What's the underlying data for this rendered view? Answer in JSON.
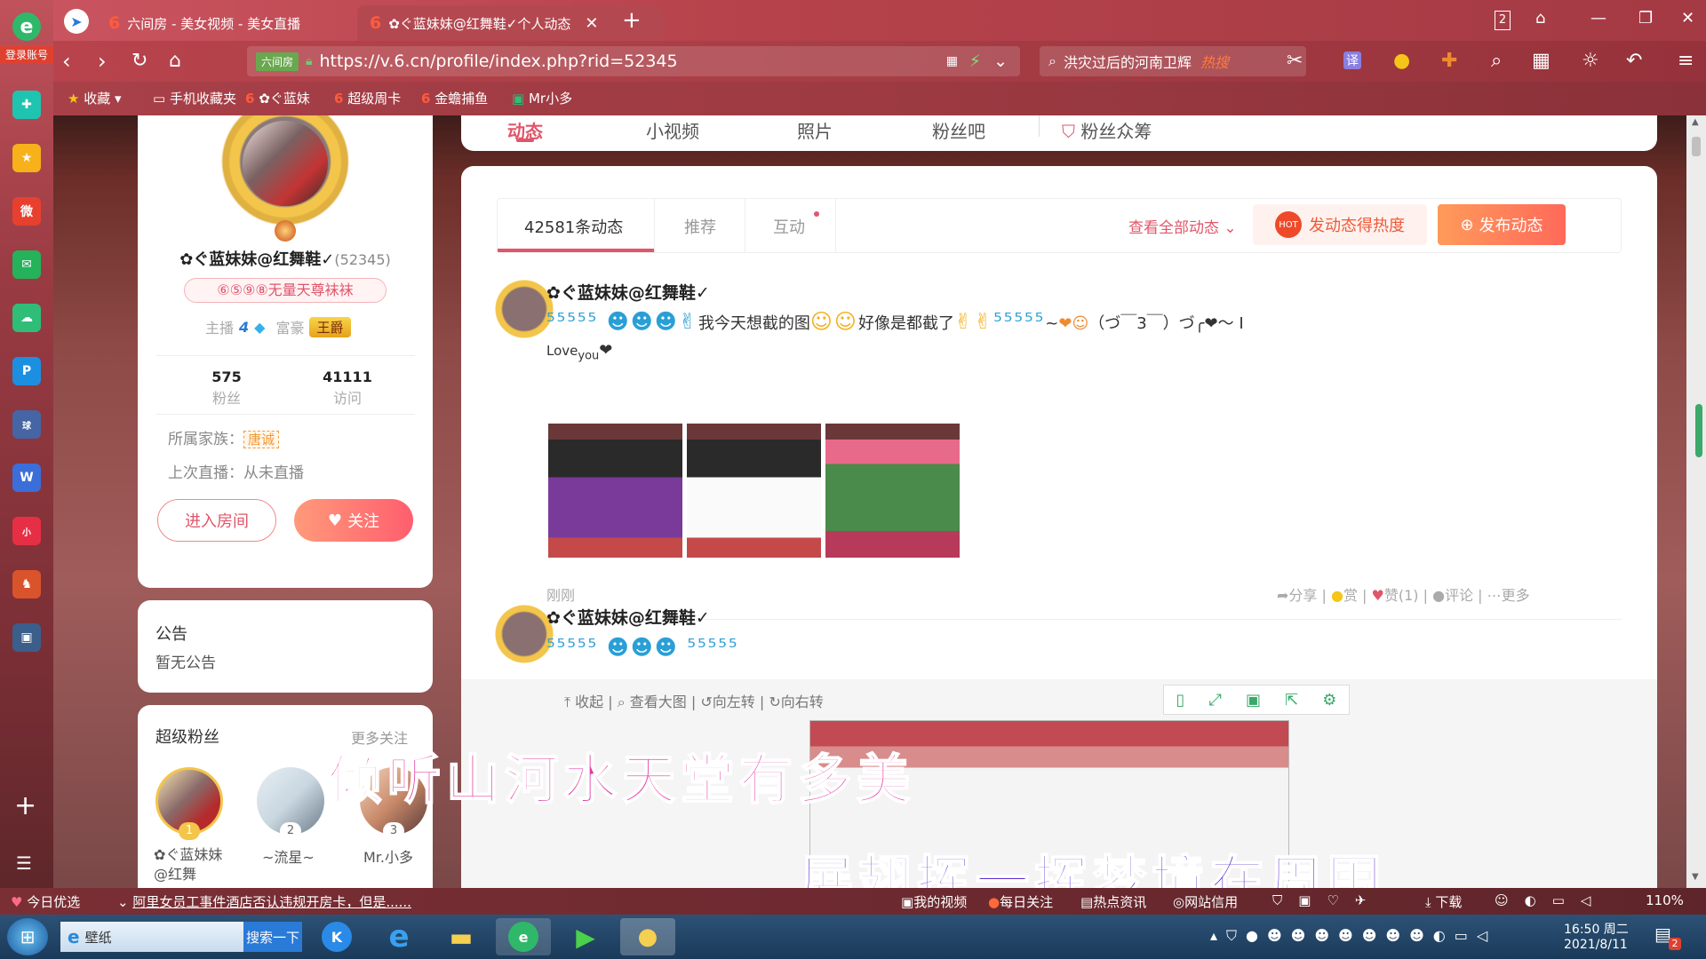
{
  "browser": {
    "tabs": [
      {
        "label": "六间房 - 美女视频 - 美女直播"
      },
      {
        "label": "✿ぐ蓝妹妹@红舞鞋✓个人动态"
      }
    ],
    "tab_count": "2",
    "url": "https://v.6.cn/profile/index.php?rid=52345",
    "shield_label": "六间房",
    "search_text": "洪灾过后的河南卫辉",
    "search_hot": "热搜",
    "login_label": "登录账号",
    "translate_label": "译",
    "bookmarks": [
      "收藏",
      "手机收藏夹",
      "✿ぐ蓝妹",
      "超级周卡",
      "金蟾捕鱼",
      "Mr小多"
    ]
  },
  "profile": {
    "name": "✿ぐ蓝妹妹@红舞鞋✓",
    "rid": "(52345)",
    "title_badge": "⑥⑤⑨⑧无量天尊袜袜",
    "anchor_label": "主播",
    "anchor_level": "4",
    "rich_label": "富豪",
    "rich_badge": "王爵",
    "fans_count": "575",
    "fans_label": "粉丝",
    "visits_count": "41111",
    "visits_label": "访问",
    "family_label": "所属家族：",
    "family_badge": "唐诚",
    "last_live": "上次直播：从未直播",
    "enter_room": "进入房间",
    "follow": "关注"
  },
  "notice": {
    "title": "公告",
    "text": "暂无公告"
  },
  "super_fans": {
    "title": "超级粉丝",
    "more": "更多关注",
    "fans": [
      {
        "rank": "1",
        "name": "✿ぐ蓝妹妹@红舞"
      },
      {
        "rank": "2",
        "name": "~流星~"
      },
      {
        "rank": "3",
        "name": "Mr.小多"
      }
    ]
  },
  "top_nav": {
    "items": [
      "动态",
      "小视频",
      "照片",
      "粉丝吧",
      "粉丝众筹"
    ]
  },
  "feed": {
    "tabs": [
      "42581条动态",
      "推荐",
      "互动"
    ],
    "view_all": "查看全部动态",
    "heat_button": "发动态得热度",
    "publish_button": "发布动态",
    "posts": [
      {
        "author": "✿ぐ蓝妹妹@红舞鞋✓",
        "text_main": "我今天想截的图",
        "text_mid": "好像是都截了",
        "text_tail": "（づ￣3￣）づ╭❤～ I",
        "text_love": "Love",
        "text_you": "you",
        "time": "刚刚",
        "actions": {
          "share": "分享",
          "reward": "赏",
          "like": "赞(1)",
          "comment": "评论",
          "more": "更多"
        }
      },
      {
        "author": "✿ぐ蓝妹妹@红舞鞋✓",
        "image_actions": [
          "收起",
          "查看大图",
          "向左转",
          "向右转"
        ]
      }
    ]
  },
  "lyrics": {
    "line1": "倾听山河水天堂有多美",
    "line2": "展翅挥一挥梦境在周围"
  },
  "status_bar": {
    "daily": "今日优选",
    "news": "阿里女员工事件酒店否认违规开房卡，但是......",
    "items": [
      "我的视频",
      "每日关注",
      "热点资讯",
      "网站信用"
    ],
    "download": "下载",
    "zoom": "110%"
  },
  "taskbar": {
    "ie_label": "壁纸",
    "search_btn": "搜索一下",
    "time": "16:50 周二",
    "date": "2021/8/11",
    "notif": "2"
  }
}
